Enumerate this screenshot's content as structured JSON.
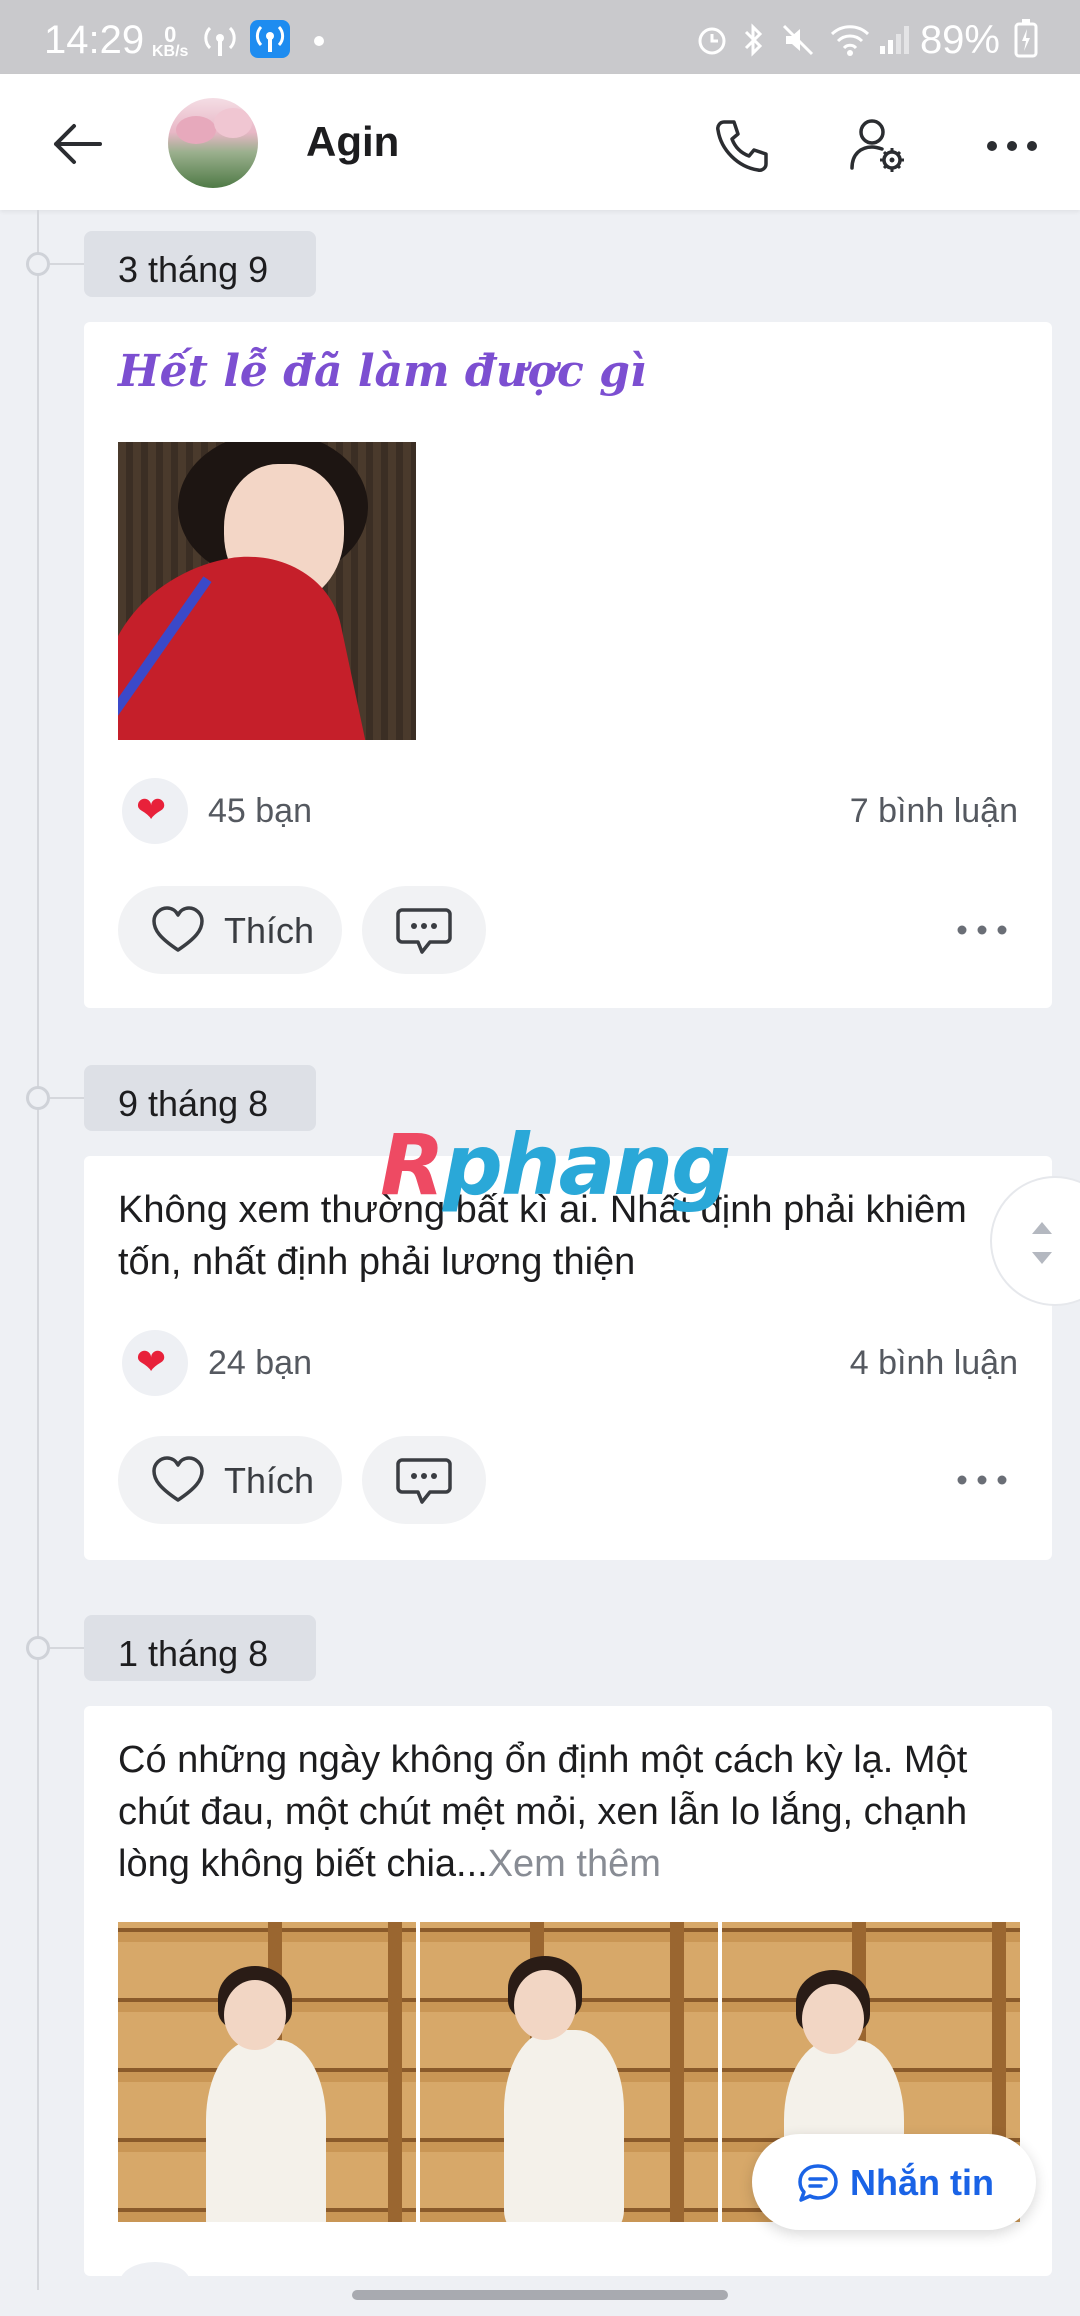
{
  "status_bar": {
    "time": "14:29",
    "net_speed_value": "0",
    "net_speed_unit": "KB/s",
    "battery": "89%"
  },
  "header": {
    "contact_name": "Agin",
    "back_icon": "arrow-left-icon",
    "call_icon": "phone-icon",
    "settings_icon": "user-settings-icon",
    "more_icon": "more-horizontal-icon"
  },
  "watermark": {
    "part1": "R",
    "part2": "phang"
  },
  "posts": [
    {
      "date": "3 tháng 9",
      "title": "Hết lễ đã làm được gì",
      "reactions": "45 bạn",
      "comments": "7 bình luận",
      "like_label": "Thích"
    },
    {
      "date": "9 tháng 8",
      "text": "Không xem thường bất kì ai. Nhất định phải khiêm tốn, nhất định phải lương thiện",
      "reactions": "24 bạn",
      "comments": "4 bình luận",
      "like_label": "Thích"
    },
    {
      "date": "1 tháng 8",
      "text": "Có những ngày không ổn định một cách kỳ lạ. Một chút đau, một chút mệt mỏi, xen lẫn lo lắng, chạnh lòng không biết chia...",
      "see_more": "Xem thêm"
    }
  ],
  "fab": {
    "label": "Nhắn tin"
  },
  "colors": {
    "accent_blue": "#1a63e6",
    "title_purple": "#7c4fd1",
    "heart_red": "#e8213a",
    "background": "#eef0f4"
  }
}
